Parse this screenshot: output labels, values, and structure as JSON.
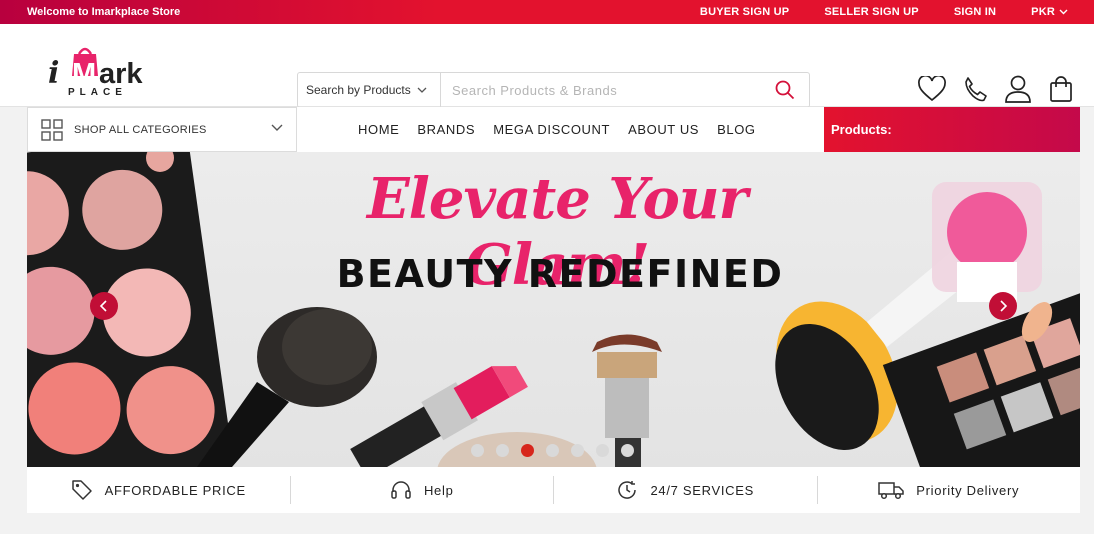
{
  "topbar": {
    "welcome": "Welcome to Imarkplace Store",
    "buyer_signup": "BUYER SIGN UP",
    "seller_signup": "SELLER SIGN UP",
    "signin": "SIGN IN",
    "currency": "PKR"
  },
  "logo": {
    "line1_a": "i",
    "line1_b": "Mark",
    "line2": "PLACE"
  },
  "search": {
    "category_label": "Search by Products",
    "placeholder": "Search Products & Brands"
  },
  "header_icons": [
    "heart-icon",
    "phone-icon",
    "user-icon",
    "bag-icon"
  ],
  "nav": {
    "shop_all": "SHOP ALL CATEGORIES",
    "items": [
      "HOME",
      "BRANDS",
      "MEGA DISCOUNT",
      "ABOUT US",
      "BLOG"
    ],
    "products_label": "Products:"
  },
  "banner": {
    "headline": "Elevate Your Glam!",
    "subline": "BEAUTY REDEFINED",
    "slides": 7,
    "active_slide": 3
  },
  "features": [
    {
      "icon": "tag-icon",
      "label": "AFFORDABLE PRICE"
    },
    {
      "icon": "headset-icon",
      "label": "Help"
    },
    {
      "icon": "clock-icon",
      "label": "24/7 SERVICES"
    },
    {
      "icon": "truck-icon",
      "label": "Priority Delivery"
    }
  ],
  "colors": {
    "brand_red": "#e3122e",
    "brand_pink": "#e8236a",
    "crimson": "#c10e36"
  }
}
